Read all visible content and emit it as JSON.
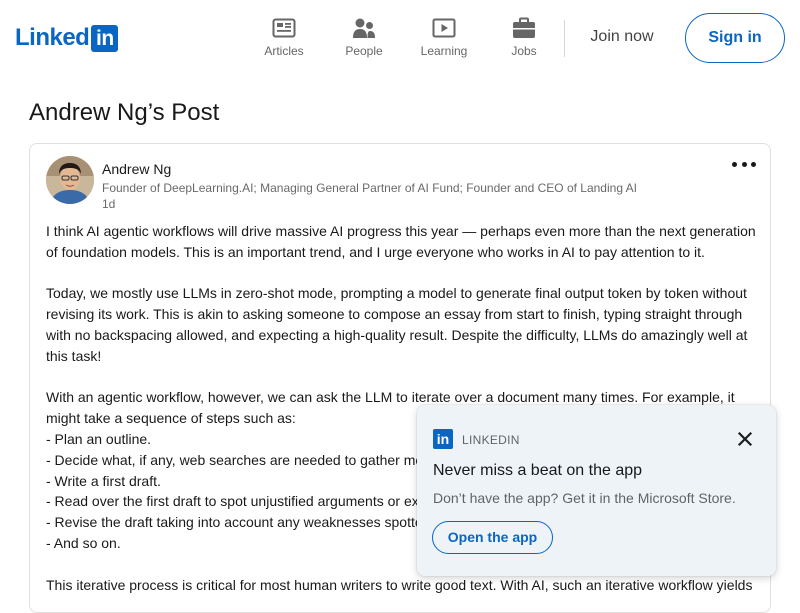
{
  "header": {
    "logo_text": "Linked",
    "logo_in": "in",
    "nav": [
      {
        "label": "Articles",
        "icon": "articles-icon"
      },
      {
        "label": "People",
        "icon": "people-icon"
      },
      {
        "label": "Learning",
        "icon": "learning-icon"
      },
      {
        "label": "Jobs",
        "icon": "jobs-icon"
      }
    ],
    "join_now": "Join now",
    "sign_in": "Sign in"
  },
  "page_title": "Andrew Ng’s Post",
  "post": {
    "author_name": "Andrew Ng",
    "author_headline": "Founder of DeepLearning.AI; Managing General Partner of AI Fund; Founder and CEO of Landing AI",
    "time": "1d",
    "more_icon": "more-options-icon",
    "paragraphs": [
      "I think AI agentic workflows will drive massive AI progress this year — perhaps even more than the next generation of foundation models. This is an important trend, and I urge everyone who works in AI to pay attention to it.",
      "Today, we mostly use LLMs in zero-shot mode, prompting a model to generate final output token by token without revising its work. This is akin to asking someone to compose an essay from start to finish, typing straight through with no backspacing allowed, and expecting a high-quality result. Despite the difficulty, LLMs do amazingly well at this task!",
      "With an agentic workflow, however, we can ask the LLM to iterate over a document many times. For example, it might take a sequence of steps such as:\n- Plan an outline.\n- Decide what, if any, web searches are needed to gather more information.\n- Write a first draft.\n- Read over the first draft to spot unjustified arguments or extraneous information.\n- Revise the draft taking into account any weaknesses spotted.\n- And so on.",
      "This iterative process is critical for most human writers to write good text. With AI, such an iterative workflow yields"
    ]
  },
  "toast": {
    "brand": "LINKEDIN",
    "logo_in": "in",
    "heading": "Never miss a beat on the app",
    "text": "Don’t have the app? Get it in the Microsoft Store.",
    "button": "Open the app",
    "close_icon": "close-icon"
  },
  "colors": {
    "brand_blue": "#0a66c2",
    "toast_bg": "#eef3f8"
  }
}
